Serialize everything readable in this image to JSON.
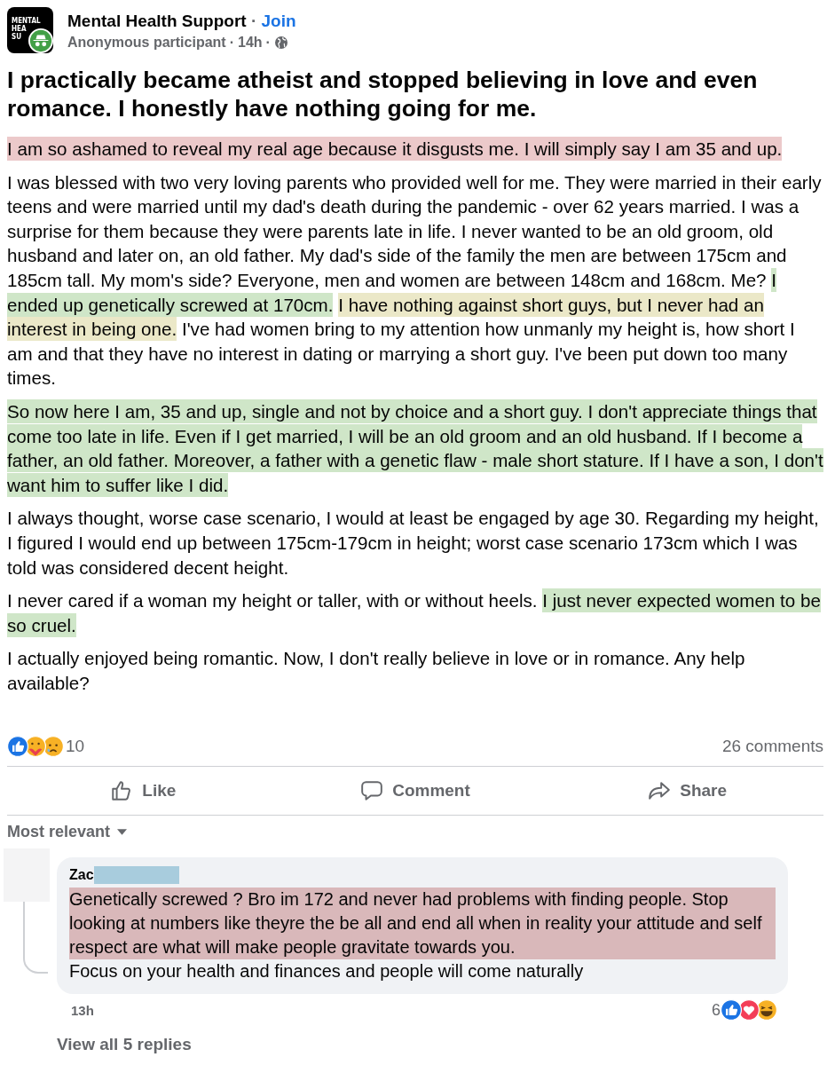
{
  "group": {
    "logo_lines": [
      "MENTAL",
      "HEA",
      "SU"
    ],
    "name": "Mental Health Support",
    "separator": "·",
    "join": "Join"
  },
  "author": {
    "name": "Anonymous participant",
    "time": "14h",
    "separator": "·"
  },
  "title": "I practically became atheist and stopped believing in love and even romance. I honestly have nothing going for me.",
  "paragraphs": [
    {
      "segments": [
        {
          "text": "I am so ashamed to reveal my real age because it disgusts me. I will simply say I am 35 and up.",
          "color": "#ecc9ca"
        }
      ]
    },
    {
      "segments": [
        {
          "text": "I was blessed with two very loving parents who provided well for me. They were married in their early teens and were married until my dad's death during the pandemic - over 62 years married. I was a surprise for them because they were parents late in life. I never wanted to be an old groom, old husband and later on, an old father. My dad's side of the family the men are between 175cm and 185cm tall. My mom's side? Everyone, men and women are between 148cm and 168cm. Me?"
        },
        {
          "text": "I ended up genetically screwed at 170cm.",
          "color": "#cfe6c8"
        },
        {
          "text": "I have nothing against short guys, but I never had an interest in being one.",
          "color": "#ebe8c8"
        },
        {
          "text": "I've had women bring to my attention how unmanly my height is, how short I am and that they have no interest in dating or marrying a short guy. I've been put down too many times."
        }
      ]
    },
    {
      "segments": [
        {
          "text": "So now here I am, 35 and up, single and not by choice and a short guy. I don't appreciate things that come too late in life. Even if I get married, I will be an old groom and an old husband. If I become a father, an old father. Moreover, a father with a genetic flaw - male short stature. If I have a son, I don't want him to suffer like I did.",
          "color": "#cfe6c8"
        }
      ]
    },
    {
      "segments": [
        {
          "text": "I always thought, worse case scenario, I would at least be engaged by age 30. Regarding my height, I figured I would end up between 175cm-179cm in height; worst case scenario 173cm which I was told was considered decent height."
        }
      ]
    },
    {
      "segments": [
        {
          "text": "I never cared if a woman my height or taller, with or without heels."
        },
        {
          "text": "I just never expected women to be so cruel.",
          "color": "#cfe6c8"
        }
      ]
    },
    {
      "segments": [
        {
          "text": "I actually enjoyed being romantic. Now, I don't really believe in love or in romance. Any help available?"
        }
      ]
    }
  ],
  "reactions": {
    "icons": [
      {
        "kind": "like"
      },
      {
        "kind": "care"
      },
      {
        "kind": "sad"
      }
    ],
    "count": "10"
  },
  "comments_count": "26 comments",
  "actions": [
    {
      "kind": "like",
      "label": "Like"
    },
    {
      "kind": "comment",
      "label": "Comment"
    },
    {
      "kind": "share",
      "label": "Share"
    }
  ],
  "sort": {
    "label": "Most relevant"
  },
  "comment": {
    "name": "Zac",
    "name_redacted": true,
    "segments": [
      {
        "text": "Genetically screwed ? Bro im 172 and never had problems with finding people. Stop looking at numbers like theyre the be all and end all when in reality your attitude and self respect are what will make people gravitate towards you.",
        "color": "#d9b8ba"
      },
      {
        "text": "Focus on your health and finances and people will come naturally"
      }
    ],
    "time": "13h",
    "reaction_count": "6",
    "reaction_icons": [
      {
        "kind": "like"
      },
      {
        "kind": "love"
      },
      {
        "kind": "haha"
      }
    ]
  },
  "view_replies": "View all 5 replies"
}
